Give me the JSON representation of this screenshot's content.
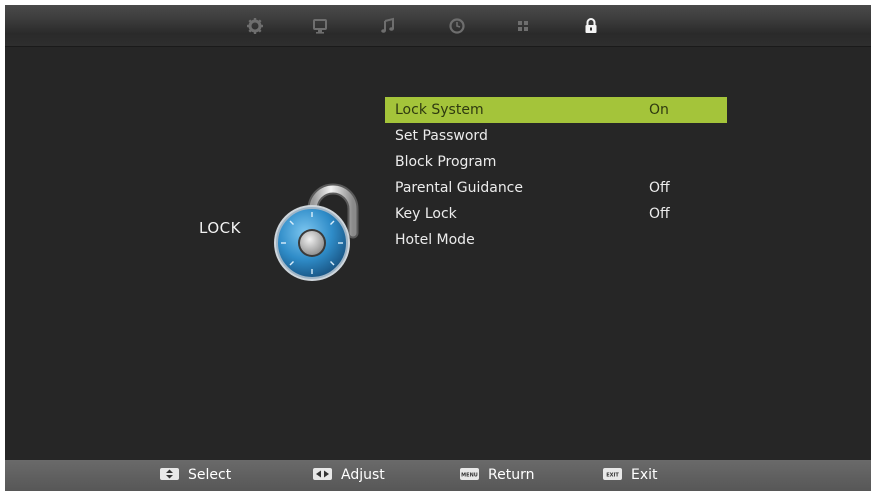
{
  "tabs": [
    {
      "name": "settings-gear-icon"
    },
    {
      "name": "picture-monitor-icon"
    },
    {
      "name": "sound-music-note-icon"
    },
    {
      "name": "time-clock-icon"
    },
    {
      "name": "channel-grid-icon"
    },
    {
      "name": "lock-padlock-icon",
      "active": true
    }
  ],
  "section": {
    "title": "LOCK"
  },
  "menu": {
    "items": [
      {
        "label": "Lock System",
        "value": "On",
        "selected": true
      },
      {
        "label": "Set Password",
        "value": ""
      },
      {
        "label": "Block Program",
        "value": ""
      },
      {
        "label": "Parental Guidance",
        "value": "Off"
      },
      {
        "label": "Key Lock",
        "value": "Off"
      },
      {
        "label": "Hotel Mode",
        "value": ""
      }
    ]
  },
  "hints": {
    "select": {
      "label": "Select",
      "icon": "up-down-arrows-icon"
    },
    "adjust": {
      "label": "Adjust",
      "icon": "left-right-arrows-icon"
    },
    "return": {
      "label": "Return",
      "icon": "menu-key-icon",
      "key_text": "MENU"
    },
    "exit": {
      "label": "Exit",
      "icon": "exit-key-icon",
      "key_text": "EXIT"
    }
  },
  "colors": {
    "highlight": "#a4c43a",
    "background": "#262626",
    "footer": "#5f5f5f",
    "lock_dial": "#2f8cc8"
  }
}
